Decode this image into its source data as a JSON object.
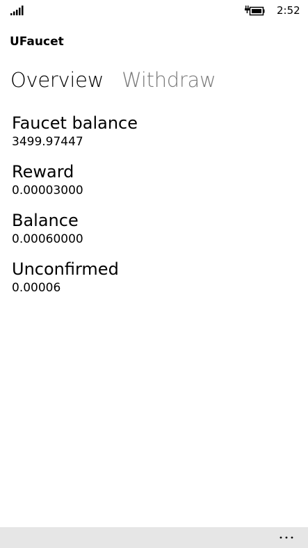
{
  "status_bar": {
    "signal_icon": "signal-strength-icon",
    "battery_icon": "battery-charging-icon",
    "time": "2:52"
  },
  "app": {
    "title": "UFaucet"
  },
  "pivot": {
    "tabs": [
      {
        "label": "Overview",
        "active": true
      },
      {
        "label": "Withdraw",
        "active": false
      }
    ]
  },
  "overview": {
    "fields": [
      {
        "label": "Faucet balance",
        "value": "3499.97447"
      },
      {
        "label": "Reward",
        "value": "0.00003000"
      },
      {
        "label": "Balance",
        "value": "0.00060000"
      },
      {
        "label": "Unconfirmed",
        "value": "0.00006"
      }
    ]
  },
  "app_bar": {
    "more_icon": "ellipsis-icon",
    "background": "#e6e6e6"
  },
  "colors": {
    "text": "#000000",
    "inactive_tab": "#7a7a7a",
    "background": "#ffffff"
  }
}
